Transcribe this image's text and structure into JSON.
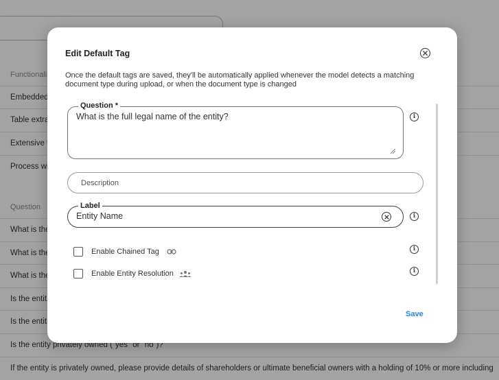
{
  "background": {
    "section_functional": "Functionali",
    "functional_rows": [
      "Embedded",
      "Table extra",
      "Extensive t",
      "Process wi"
    ],
    "section_question": "Question",
    "question_rows": [
      "What is the",
      "What is the",
      "What is the",
      "Is the entit",
      "Is the entit",
      "Is the entity privately owned (\"yes\" or \"no\")?",
      "If the entity is privately owned, please provide details of shareholders or ultimate beneficial owners with a holding of 10% or more including"
    ]
  },
  "modal": {
    "title": "Edit Default Tag",
    "description": "Once the default tags are saved, they'll be automatically applied whenever the model detects a matching document type during upload, or when the document type is changed",
    "question": {
      "legend": "Question *",
      "value": "What is the full legal name of the entity?"
    },
    "description_field": {
      "placeholder": "Description"
    },
    "label": {
      "legend": "Label",
      "value": "Entity Name"
    },
    "enable_chained_tag": {
      "label": "Enable Chained Tag",
      "checked": false
    },
    "enable_entity_resolution": {
      "label": "Enable Entity Resolution",
      "checked": false
    },
    "save_label": "Save"
  },
  "icons": {
    "close": "close-circle-icon",
    "info": "info-icon",
    "clear": "clear-circle-icon",
    "link": "link-icon",
    "group": "group-icon"
  }
}
